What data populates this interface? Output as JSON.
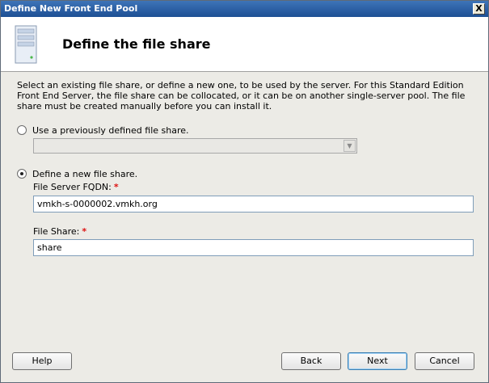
{
  "window": {
    "title": "Define New Front End Pool",
    "close_label": "X"
  },
  "header": {
    "title": "Define the file share",
    "icon": "server-icon"
  },
  "description": "Select an existing file share, or define a new one, to be used by the server. For this Standard Edition Front End Server, the file share can be collocated, or it can be on another single-server pool.  The file share must be created manually before you can install it.",
  "options": {
    "existing": {
      "label": "Use a previously defined file share.",
      "selected": false,
      "combo_value": ""
    },
    "new": {
      "label": "Define a new file share.",
      "selected": true
    }
  },
  "fields": {
    "fqdn": {
      "label": "File Server FQDN:",
      "required_mark": "*",
      "value": "vmkh-s-0000002.vmkh.org"
    },
    "share": {
      "label": "File Share:",
      "required_mark": "*",
      "value": "share"
    }
  },
  "buttons": {
    "help": "Help",
    "back": "Back",
    "next": "Next",
    "cancel": "Cancel"
  },
  "colors": {
    "title_bar": "#2a5ea6",
    "required": "#d11111",
    "dialog_bg": "#ecebe6"
  }
}
